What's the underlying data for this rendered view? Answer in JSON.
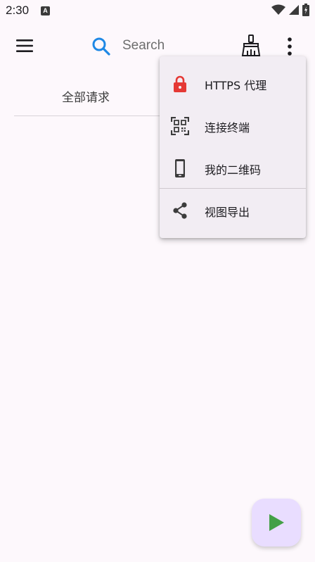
{
  "status_bar": {
    "time": "2:30",
    "app_indicator": "A"
  },
  "toolbar": {
    "menu_icon": "hamburger-menu-icon",
    "search_placeholder": "Search",
    "clean_icon": "broom-icon",
    "more_icon": "more-vert-icon"
  },
  "tabs": [
    {
      "label": "全部请求"
    }
  ],
  "overflow_menu": {
    "items": [
      {
        "label": "HTTPS 代理",
        "icon": "lock-icon",
        "color": "#e53935"
      },
      {
        "label": "连接终端",
        "icon": "qr-scan-icon"
      },
      {
        "label": "我的二维码",
        "icon": "phone-icon"
      },
      {
        "label": "视图导出",
        "icon": "share-icon"
      }
    ]
  },
  "fab": {
    "icon": "play-icon",
    "color": "#43a047"
  }
}
